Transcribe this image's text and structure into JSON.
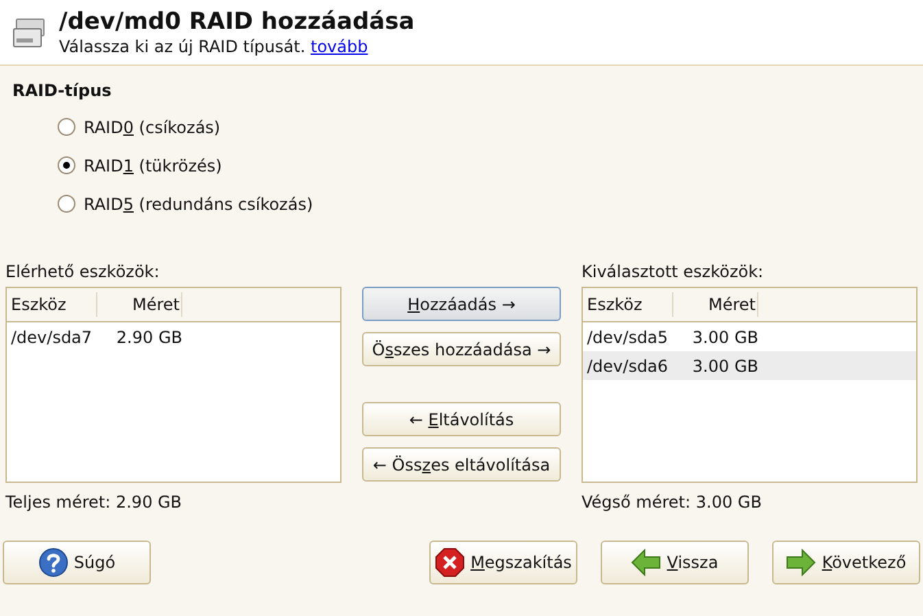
{
  "header": {
    "title": "/dev/md0 RAID hozzáadása",
    "subtitle": "Válassza ki az új RAID típusát.",
    "link": "tovább"
  },
  "raid_type": {
    "heading": "RAID-típus",
    "options": [
      {
        "pre": "RAID",
        "key": "0",
        "post": " (csíkozás)",
        "selected": false
      },
      {
        "pre": "RAID",
        "key": "1",
        "post": " (tükrözés)",
        "selected": true
      },
      {
        "pre": "RAID",
        "key": "5",
        "post": " (redundáns csíkozás)",
        "selected": false
      }
    ]
  },
  "available": {
    "label": "Elérhető eszközök:",
    "columns": [
      "Eszköz",
      "Méret"
    ],
    "rows": [
      {
        "device": "/dev/sda7",
        "size": "2.90 GB",
        "selected": false
      }
    ],
    "total": "Teljes méret: 2.90 GB"
  },
  "actions": [
    {
      "key": "H",
      "post": "ozzáadás →",
      "focused": true
    },
    {
      "pre": "Ö",
      "key": "s",
      "post": "szes hozzáadása →",
      "focused": false
    },
    {
      "pre": "← ",
      "key": "E",
      "post": "ltávolítás",
      "focused": false
    },
    {
      "pre": "← Öss",
      "key": "z",
      "post": "es eltávolítása",
      "focused": false
    }
  ],
  "selected_devices": {
    "label": "Kiválasztott eszközök:",
    "columns": [
      "Eszköz",
      "Méret"
    ],
    "rows": [
      {
        "device": "/dev/sda5",
        "size": "3.00 GB",
        "selected": false
      },
      {
        "device": "/dev/sda6",
        "size": "3.00 GB",
        "selected": true
      }
    ],
    "total": "Végső méret: 3.00 GB"
  },
  "buttons": [
    {
      "kind": "help",
      "post": "Súgó"
    },
    {
      "kind": "cancel",
      "key": "M",
      "post": "egszakítás"
    },
    {
      "kind": "back",
      "key": "V",
      "post": "issza"
    },
    {
      "kind": "next",
      "key": "K",
      "post": "övetkező"
    }
  ]
}
